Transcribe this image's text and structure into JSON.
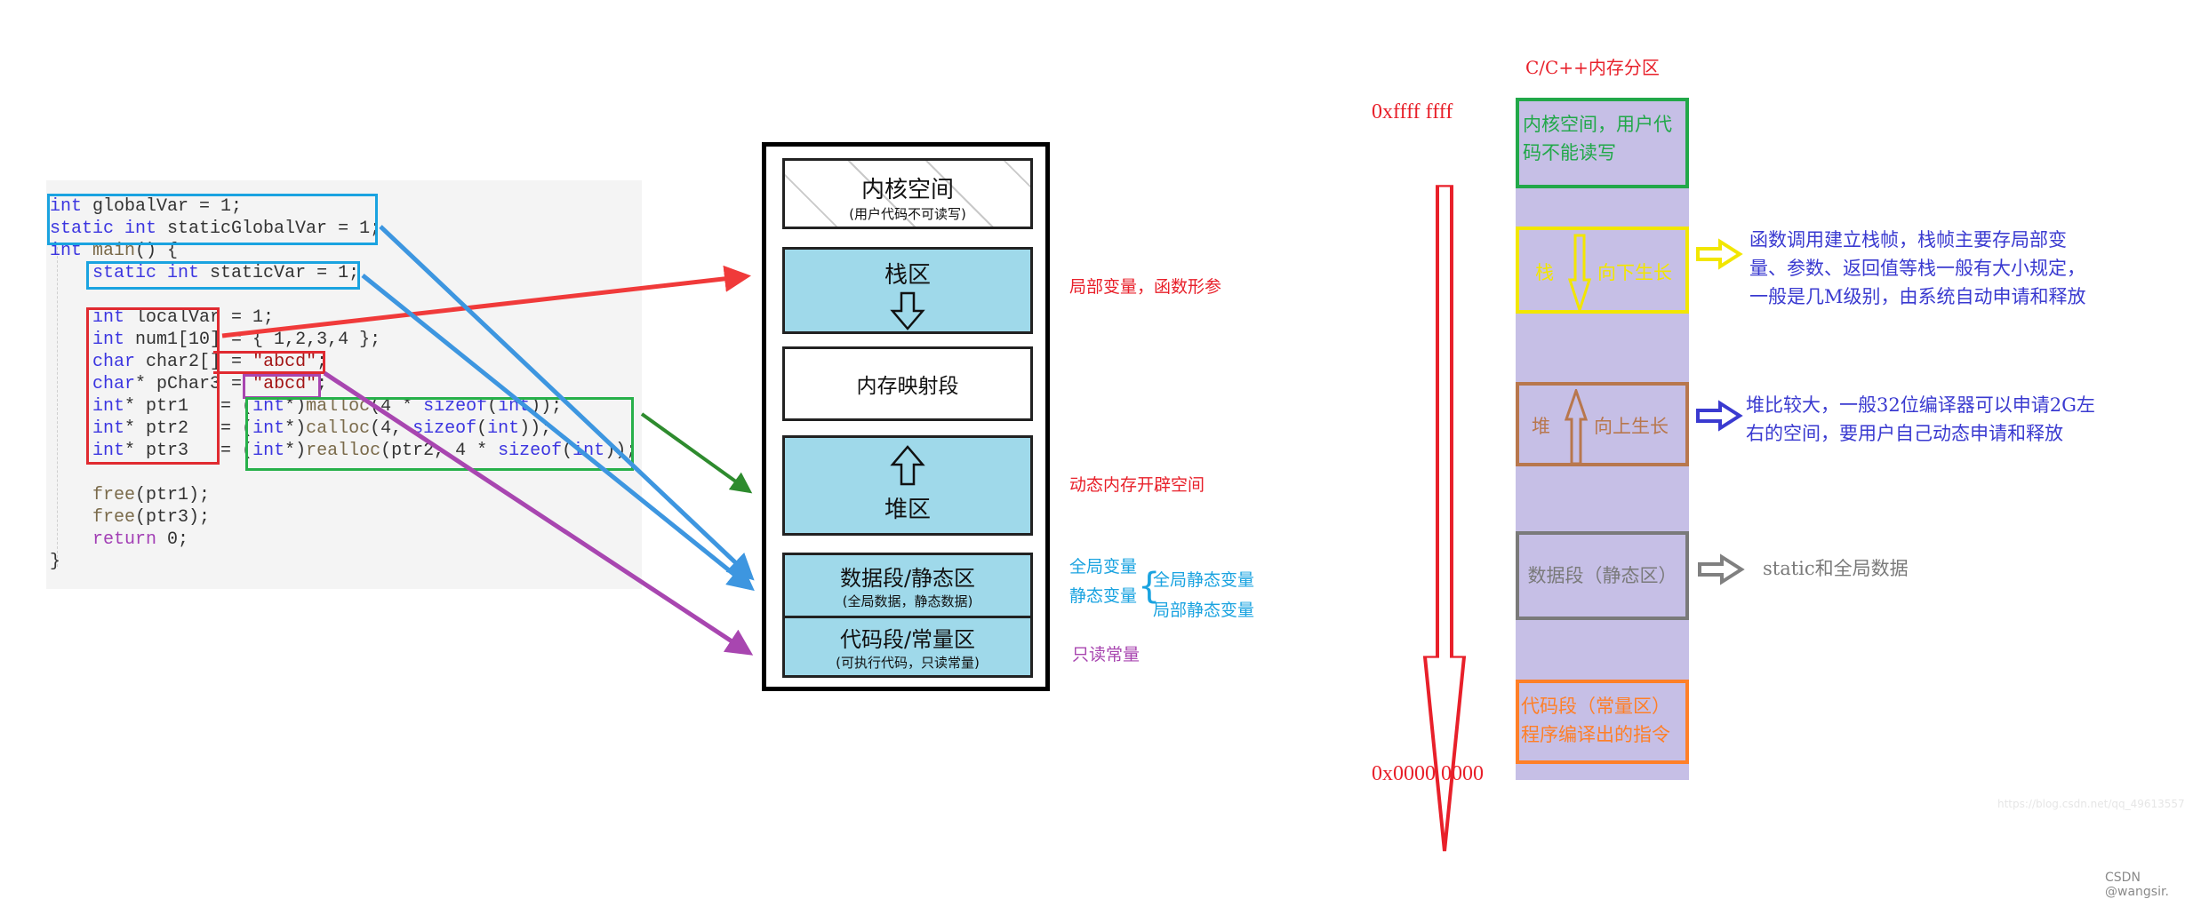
{
  "code": {
    "lines": [
      {
        "parts": [
          {
            "t": "int",
            "c": "kw"
          },
          {
            "t": " globalVar = 1;",
            "c": ""
          }
        ]
      },
      {
        "parts": [
          {
            "t": "static int",
            "c": "kw"
          },
          {
            "t": " staticGlobalVar = 1;",
            "c": ""
          }
        ]
      },
      {
        "parts": [
          {
            "t": "int",
            "c": "kw"
          },
          {
            "t": " ",
            "c": ""
          },
          {
            "t": "main",
            "c": "fn"
          },
          {
            "t": "() {",
            "c": ""
          }
        ]
      },
      {
        "parts": [
          {
            "t": "    ",
            "c": ""
          },
          {
            "t": "static int",
            "c": "kw"
          },
          {
            "t": " staticVar = 1;",
            "c": ""
          }
        ]
      },
      {
        "parts": [
          {
            "t": "",
            "c": ""
          }
        ]
      },
      {
        "parts": [
          {
            "t": "    ",
            "c": ""
          },
          {
            "t": "int",
            "c": "kw"
          },
          {
            "t": " localVar = 1;",
            "c": ""
          }
        ]
      },
      {
        "parts": [
          {
            "t": "    ",
            "c": ""
          },
          {
            "t": "int",
            "c": "kw"
          },
          {
            "t": " num1[10] = { 1,2,3,4 };",
            "c": ""
          }
        ]
      },
      {
        "parts": [
          {
            "t": "    ",
            "c": ""
          },
          {
            "t": "char",
            "c": "kw"
          },
          {
            "t": " char2[] = ",
            "c": ""
          },
          {
            "t": "\"abcd\"",
            "c": "str"
          },
          {
            "t": ";",
            "c": ""
          }
        ]
      },
      {
        "parts": [
          {
            "t": "    ",
            "c": ""
          },
          {
            "t": "char",
            "c": "kw"
          },
          {
            "t": "* pChar3 = ",
            "c": ""
          },
          {
            "t": "\"abcd\"",
            "c": "str"
          },
          {
            "t": ";",
            "c": ""
          }
        ]
      },
      {
        "parts": [
          {
            "t": "    ",
            "c": ""
          },
          {
            "t": "int",
            "c": "kw"
          },
          {
            "t": "* ptr1   = (",
            "c": ""
          },
          {
            "t": "int",
            "c": "kw"
          },
          {
            "t": "*)",
            "c": ""
          },
          {
            "t": "malloc",
            "c": "fn"
          },
          {
            "t": "(4 * ",
            "c": ""
          },
          {
            "t": "sizeof",
            "c": "kw"
          },
          {
            "t": "(",
            "c": ""
          },
          {
            "t": "int",
            "c": "kw"
          },
          {
            "t": "));",
            "c": ""
          }
        ]
      },
      {
        "parts": [
          {
            "t": "    ",
            "c": ""
          },
          {
            "t": "int",
            "c": "kw"
          },
          {
            "t": "* ptr2   = (",
            "c": ""
          },
          {
            "t": "int",
            "c": "kw"
          },
          {
            "t": "*)",
            "c": ""
          },
          {
            "t": "calloc",
            "c": "fn"
          },
          {
            "t": "(4, ",
            "c": ""
          },
          {
            "t": "sizeof",
            "c": "kw"
          },
          {
            "t": "(",
            "c": ""
          },
          {
            "t": "int",
            "c": "kw"
          },
          {
            "t": "));",
            "c": ""
          }
        ]
      },
      {
        "parts": [
          {
            "t": "    ",
            "c": ""
          },
          {
            "t": "int",
            "c": "kw"
          },
          {
            "t": "* ptr3   = (",
            "c": ""
          },
          {
            "t": "int",
            "c": "kw"
          },
          {
            "t": "*)",
            "c": ""
          },
          {
            "t": "realloc",
            "c": "fn"
          },
          {
            "t": "(ptr2, 4 * ",
            "c": ""
          },
          {
            "t": "sizeof",
            "c": "kw"
          },
          {
            "t": "(",
            "c": ""
          },
          {
            "t": "int",
            "c": "kw"
          },
          {
            "t": "));",
            "c": ""
          }
        ]
      },
      {
        "parts": [
          {
            "t": "",
            "c": ""
          }
        ]
      },
      {
        "parts": [
          {
            "t": "    ",
            "c": ""
          },
          {
            "t": "free",
            "c": "fn"
          },
          {
            "t": "(ptr1);",
            "c": ""
          }
        ]
      },
      {
        "parts": [
          {
            "t": "    ",
            "c": ""
          },
          {
            "t": "free",
            "c": "fn"
          },
          {
            "t": "(ptr3);",
            "c": ""
          }
        ]
      },
      {
        "parts": [
          {
            "t": "    ",
            "c": ""
          },
          {
            "t": "return",
            "c": "ret"
          },
          {
            "t": " 0;",
            "c": ""
          }
        ]
      },
      {
        "parts": [
          {
            "t": "}",
            "c": ""
          }
        ]
      }
    ]
  },
  "memory_layout": {
    "segments": [
      {
        "title": "内核空间",
        "subtitle": "(用户代码不可读写)"
      },
      {
        "title": "栈区",
        "subtitle": ""
      },
      {
        "title": "内存映射段",
        "subtitle": ""
      },
      {
        "title": "堆区",
        "subtitle": ""
      },
      {
        "title": "数据段/静态区",
        "subtitle": "(全局数据，静态数据)"
      },
      {
        "title": "代码段/常量区",
        "subtitle": "(可执行代码，只读常量)"
      }
    ],
    "labels": {
      "stack": "局部变量，函数形参",
      "heap": "动态内存开辟空间",
      "global_vars": "全局变量",
      "static_vars": "静态变量",
      "global_static": "全局静态变量",
      "local_static": "局部静态变量",
      "readonly": "只读常量"
    }
  },
  "partition": {
    "title": "C/C++内存分区",
    "addr_high": "0xffff ffff",
    "addr_low": "0x0000 0000",
    "kernel": "内核空间，用户代码不能读写",
    "stack_name": "栈",
    "stack_growth": "向下生长",
    "stack_desc": [
      "函数调用建立栈帧，栈帧主要存局部变",
      "量、参数、返回值等栈一般有大小规定，",
      "一般是几M级别，由系统自动申请和释放"
    ],
    "heap_name": "堆",
    "heap_growth": "向上生长",
    "heap_desc": [
      "堆比较大，一般32位编译器可以申请2G左",
      "右的空间，要用户自己动态申请和释放"
    ],
    "data_seg": "数据段（静态区）",
    "data_desc": "static和全局数据",
    "code_seg": [
      "代码段（常量区）",
      "程序编译出的指令"
    ]
  },
  "colors": {
    "blue_arrow": "#3d96e0",
    "red_arrow": "#f03a3a",
    "green_arrow": "#2e8b2e",
    "purple_arrow": "#a846b0",
    "segment_fill": "#9fd9ea",
    "partition_fill": "#c6bfe6"
  },
  "watermark": "https://blog.csdn.net/qq_49613557",
  "credit": "CSDN @wangsir."
}
